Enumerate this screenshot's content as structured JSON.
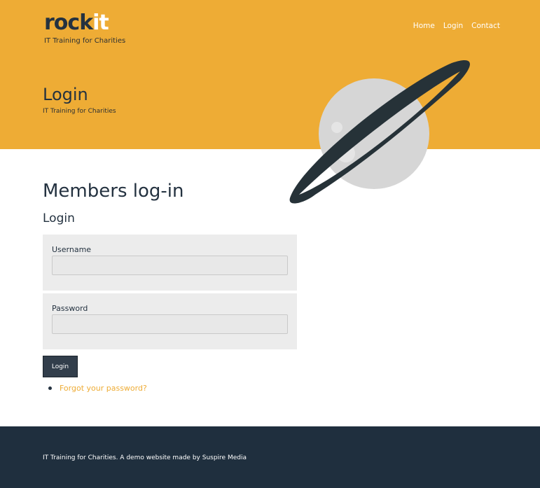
{
  "brand": {
    "logo_main": "rock",
    "logo_accent": "it",
    "tagline": "IT Training for Charities"
  },
  "nav": {
    "items": [
      "Home",
      "Login",
      "Contact"
    ]
  },
  "hero": {
    "title": "Login",
    "subtitle": "IT Training for Charities"
  },
  "main": {
    "title": "Members log-in",
    "subtitle": "Login"
  },
  "form": {
    "username_label": "Username",
    "username_value": "",
    "password_label": "Password",
    "password_value": "",
    "submit_label": "Login"
  },
  "links": {
    "forgot_password": "Forgot your password?"
  },
  "footer": {
    "text": "IT Training for Charities. A demo website made by Suspire Media"
  },
  "colors": {
    "brand_yellow": "#eeac35",
    "dark_navy": "#1f2f3e",
    "button": "#323e4b",
    "planet": "#d6d6d6",
    "ring": "#263238"
  },
  "icons": {
    "hero_illustration": "planet-illustration",
    "list_bullet": "bullet-dot"
  }
}
